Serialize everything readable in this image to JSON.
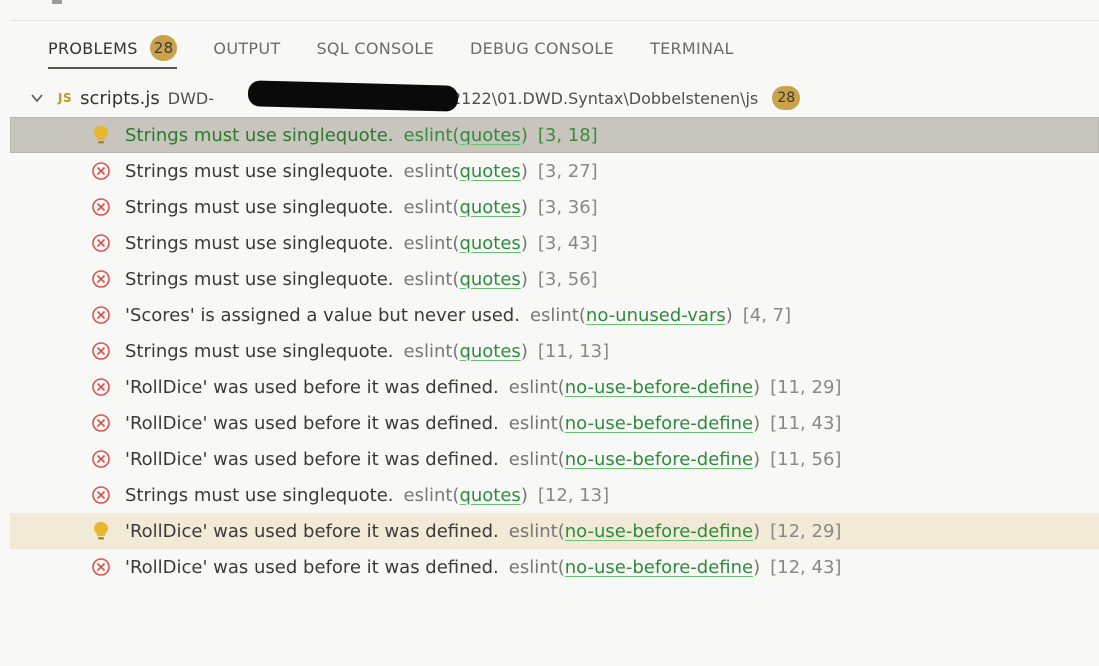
{
  "colors": {
    "error": "#d9534f",
    "warning_bulb": "#e8b730",
    "badge": "#c9a24a",
    "rule_link": "#2e8b3e",
    "selected_row": "#c8c5bf"
  },
  "tabs": [
    {
      "label": "PROBLEMS",
      "badge": "28",
      "active": true
    },
    {
      "label": "OUTPUT"
    },
    {
      "label": "SQL CONSOLE"
    },
    {
      "label": "DEBUG CONSOLE"
    },
    {
      "label": "TERMINAL"
    }
  ],
  "file": {
    "icon": "JS",
    "name": "scripts.js",
    "path_prefix": "DWD-",
    "path_suffix": "2122\\01.DWD.Syntax\\Dobbelstenen\\js",
    "count": "28"
  },
  "problems": [
    {
      "severity": "lightbulb",
      "message": "Strings must use singlequote.",
      "source": "eslint",
      "code": "quotes",
      "pos": "[3, 18]",
      "state": "selected"
    },
    {
      "severity": "error",
      "message": "Strings must use singlequote.",
      "source": "eslint",
      "code": "quotes",
      "pos": "[3, 27]"
    },
    {
      "severity": "error",
      "message": "Strings must use singlequote.",
      "source": "eslint",
      "code": "quotes",
      "pos": "[3, 36]"
    },
    {
      "severity": "error",
      "message": "Strings must use singlequote.",
      "source": "eslint",
      "code": "quotes",
      "pos": "[3, 43]"
    },
    {
      "severity": "error",
      "message": "Strings must use singlequote.",
      "source": "eslint",
      "code": "quotes",
      "pos": "[3, 56]"
    },
    {
      "severity": "error",
      "message": "'Scores' is assigned a value but never used.",
      "source": "eslint",
      "code": "no-unused-vars",
      "pos": "[4, 7]"
    },
    {
      "severity": "error",
      "message": "Strings must use singlequote.",
      "source": "eslint",
      "code": "quotes",
      "pos": "[11, 13]"
    },
    {
      "severity": "error",
      "message": "'RollDice' was used before it was defined.",
      "source": "eslint",
      "code": "no-use-before-define",
      "pos": "[11, 29]"
    },
    {
      "severity": "error",
      "message": "'RollDice' was used before it was defined.",
      "source": "eslint",
      "code": "no-use-before-define",
      "pos": "[11, 43]"
    },
    {
      "severity": "error",
      "message": "'RollDice' was used before it was defined.",
      "source": "eslint",
      "code": "no-use-before-define",
      "pos": "[11, 56]"
    },
    {
      "severity": "error",
      "message": "Strings must use singlequote.",
      "source": "eslint",
      "code": "quotes",
      "pos": "[12, 13]"
    },
    {
      "severity": "lightbulb",
      "message": "'RollDice' was used before it was defined.",
      "source": "eslint",
      "code": "no-use-before-define",
      "pos": "[12, 29]",
      "state": "hover"
    },
    {
      "severity": "error",
      "message": "'RollDice' was used before it was defined.",
      "source": "eslint",
      "code": "no-use-before-define",
      "pos": "[12, 43]"
    }
  ]
}
